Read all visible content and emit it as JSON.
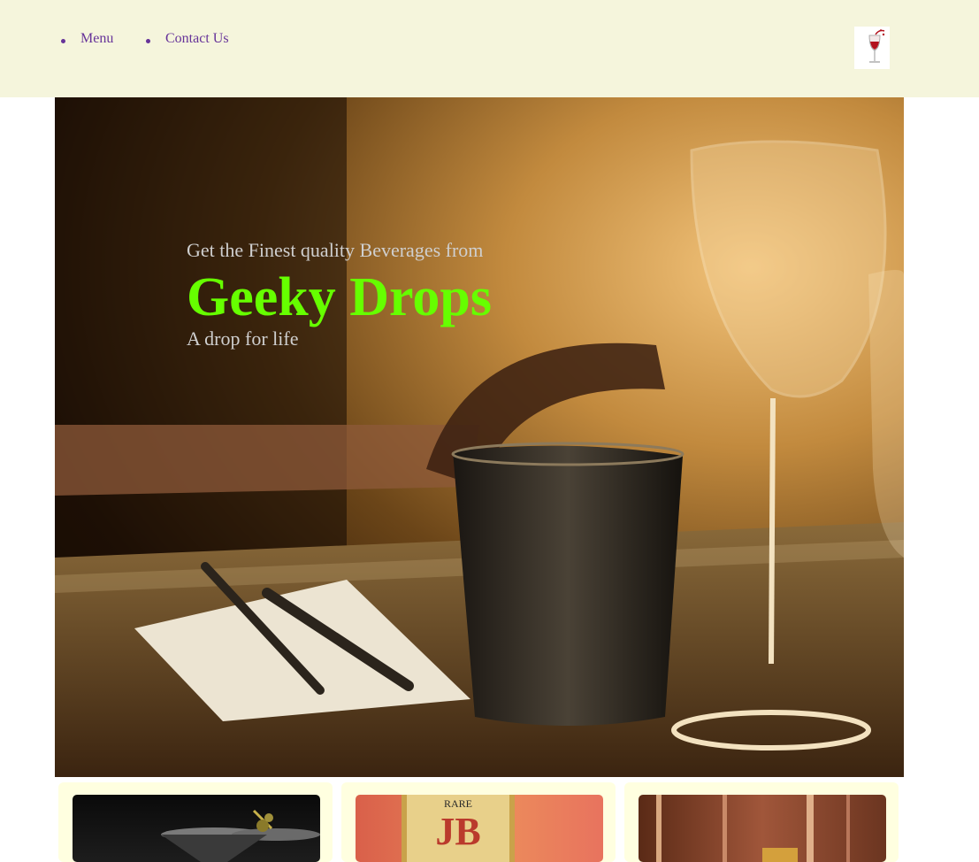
{
  "nav": {
    "items": [
      {
        "label": "Menu"
      },
      {
        "label": "Contact Us"
      }
    ]
  },
  "logo": {
    "icon": "wine-glass-logo-icon"
  },
  "hero": {
    "tagline": "Get the Finest quality Beverages from",
    "brand": "Geeky Drops",
    "slogan": "A drop for life",
    "image": "restaurant-table-glasses-image"
  },
  "cards": [
    {
      "image": "martini-glasses-image"
    },
    {
      "image": "jb-rare-whisky-image"
    },
    {
      "image": "bar-bottles-image"
    }
  ],
  "colors": {
    "topbar_bg": "#f5f5dc",
    "nav_link": "#663399",
    "brand_text": "#66ff00",
    "hero_text": "#cfcfcf",
    "card_bg": "#ffffe0"
  }
}
